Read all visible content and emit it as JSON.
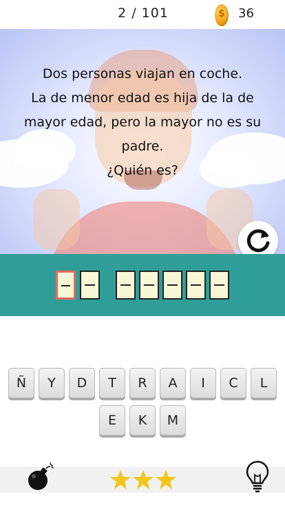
{
  "header": {
    "level": "2 / 101",
    "coins": "36",
    "coin_icon": "coin-icon"
  },
  "riddle": {
    "lines": [
      "Dos personas viajan en coche.",
      "La de menor edad es hija de la de",
      "mayor edad, pero la mayor no es su",
      "padre.",
      "¿Quién es?"
    ]
  },
  "actions": {
    "refresh_icon": "refresh-icon"
  },
  "answer": {
    "word_lengths": [
      2,
      5
    ],
    "filled": [
      "",
      "",
      "",
      "",
      "",
      "",
      ""
    ],
    "active_slot": 0
  },
  "keyboard": {
    "row1": [
      "Ñ",
      "Y",
      "D",
      "T",
      "R",
      "A",
      "I",
      "C",
      "L"
    ],
    "row2": [
      "E",
      "K",
      "M"
    ]
  },
  "footer": {
    "stars": 3,
    "max_stars": 3,
    "bomb_icon": "bomb-icon",
    "hint_icon": "lightbulb-icon"
  },
  "colors": {
    "answer_band": "#2f9e98",
    "active_slot_border": "#e26a5a",
    "star": "#f5c518",
    "coin": "#f5a623"
  }
}
